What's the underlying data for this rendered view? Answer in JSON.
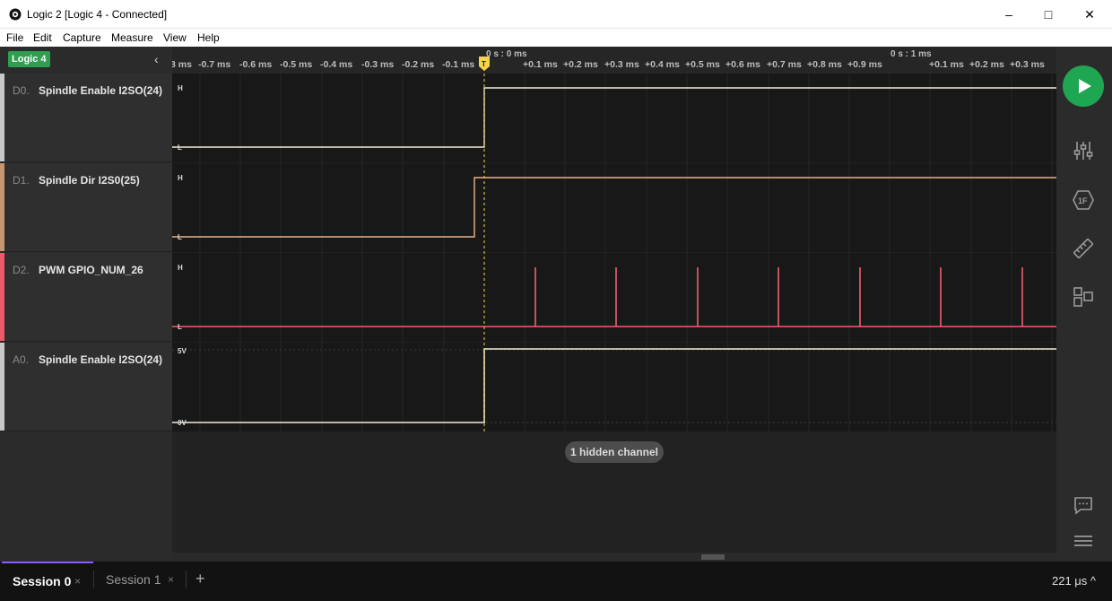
{
  "window": {
    "title": "Logic 2 [Logic 4 - Connected]",
    "minimize": "–",
    "maximize": "□",
    "close": "✕"
  },
  "menu": [
    "File",
    "Edit",
    "Capture",
    "Measure",
    "View",
    "Help"
  ],
  "sidebar": {
    "device": "Logic 4",
    "collapse": "‹",
    "channels": [
      {
        "id": "D0.",
        "name": "Spindle Enable I2SO(24)",
        "color": "#c8c8c8"
      },
      {
        "id": "D1.",
        "name": "Spindle Dir I2S0(25)",
        "color": "#c7956f"
      },
      {
        "id": "D2.",
        "name": "PWM GPIO_NUM_26",
        "color": "#ef5a68"
      },
      {
        "id": "A0.",
        "name": "Spindle Enable I2SO(24)",
        "color": "#c8c8c8"
      }
    ]
  },
  "timeline": {
    "ticks": [
      "3 ms",
      "-0.7 ms",
      "-0.6 ms",
      "-0.5 ms",
      "-0.4 ms",
      "-0.3 ms",
      "-0.2 ms",
      "-0.1 ms",
      "+0.1 ms",
      "+0.2 ms",
      "+0.3 ms",
      "+0.4 ms",
      "+0.5 ms",
      "+0.6 ms",
      "+0.7 ms",
      "+0.8 ms",
      "+0.9 ms",
      "+0.1 ms",
      "+0.2 ms",
      "+0.3 ms"
    ],
    "marker_a": "0 s : 0 ms",
    "marker_b": "0 s : 1 ms",
    "trigger": "T"
  },
  "trace_labels": {
    "high": "H",
    "low": "L",
    "v5": "5V",
    "v0": "0V"
  },
  "hidden_channels": "1 hidden channel",
  "tabs": [
    {
      "label": "Session 0",
      "close": "×",
      "active": true
    },
    {
      "label": "Session 1",
      "close": "×",
      "active": false
    }
  ],
  "add_tab": "+",
  "status": "221 μs ^",
  "colors": {
    "accent": "#1fa653",
    "trace_white": "#f3ecd6",
    "trace_tan": "#e8b588",
    "trace_red": "#f0606d",
    "trigger": "#f4d44a"
  }
}
